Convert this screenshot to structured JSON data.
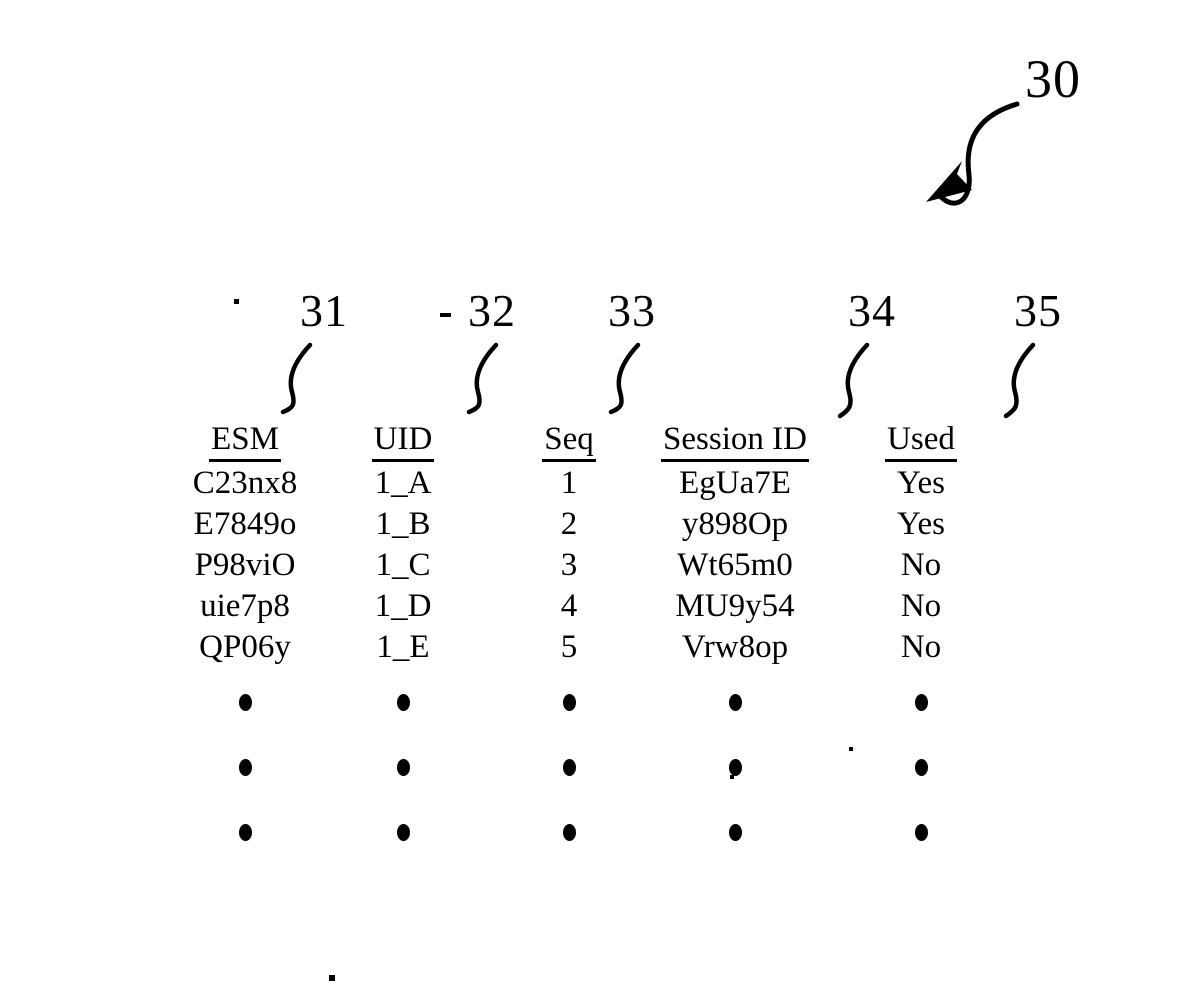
{
  "figure": {
    "number": "30",
    "title_numeral": "30",
    "callouts": [
      {
        "numeral": "31",
        "target": "ESM"
      },
      {
        "numeral": "32",
        "target": "UID"
      },
      {
        "numeral": "33",
        "target": "Seq"
      },
      {
        "numeral": "34",
        "target": "Session ID"
      },
      {
        "numeral": "35",
        "target": "Used"
      }
    ]
  },
  "table": {
    "headers": [
      "ESM",
      "UID",
      "Seq",
      "Session ID",
      "Used"
    ],
    "rows": [
      {
        "esm": "C23nx8",
        "uid": "1_A",
        "seq": "1",
        "session_id": "EgUa7E",
        "used": "Yes"
      },
      {
        "esm": "E7849o",
        "uid": "1_B",
        "seq": "2",
        "session_id": "y898Op",
        "used": "Yes"
      },
      {
        "esm": "P98viO",
        "uid": "1_C",
        "seq": "3",
        "session_id": "Wt65m0",
        "used": "No"
      },
      {
        "esm": "uie7p8",
        "uid": "1_D",
        "seq": "4",
        "session_id": "MU9y54",
        "used": "No"
      },
      {
        "esm": "QP06y",
        "uid": "1_E",
        "seq": "5",
        "session_id": "Vrw8op",
        "used": "No"
      }
    ],
    "continuation_rows": 3,
    "continuation_glyph": "vertical-ellipsis-dot"
  },
  "style": {
    "ink_color": "#000000",
    "paper_color": "#ffffff"
  }
}
